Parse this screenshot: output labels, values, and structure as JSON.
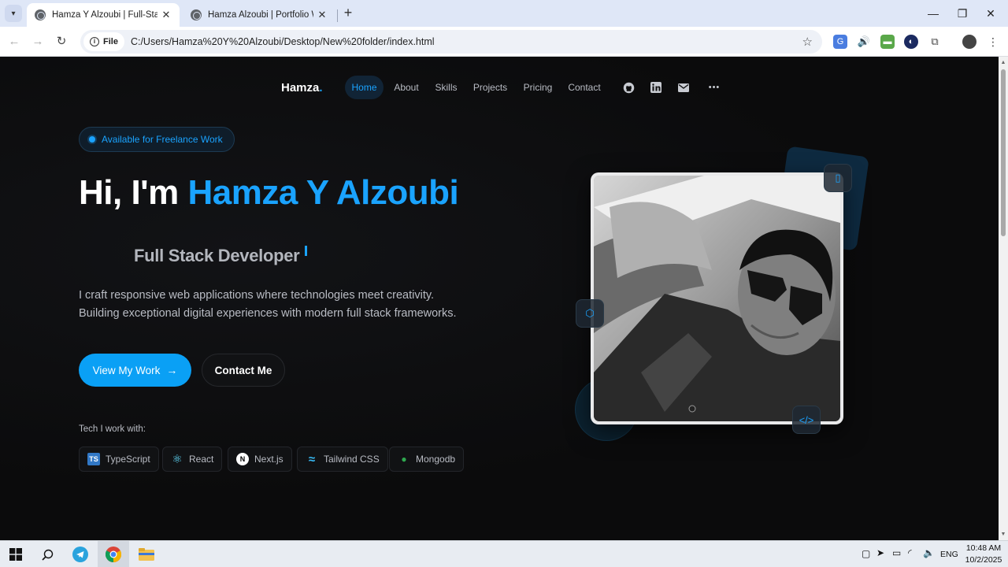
{
  "browser": {
    "tabs": [
      {
        "title": "Hamza Y Alzoubi | Full-Stack We",
        "active": true
      },
      {
        "title": "Hamza Alzoubi | Portfolio Webs",
        "active": false
      }
    ],
    "new_tab": "+",
    "window_controls": {
      "minimize": "—",
      "maximize": "❐",
      "close": "✕"
    },
    "site_chip": "File",
    "url": "C:/Users/Hamza%20Y%20Alzoubi/Desktop/New%20folder/index.html"
  },
  "nav": {
    "logo": "Hamza",
    "logo_dot": ".",
    "links": [
      "Home",
      "About",
      "Skills",
      "Projects",
      "Pricing",
      "Contact"
    ],
    "more": "•••"
  },
  "hero": {
    "badge": "Available for Freelance Work",
    "greeting": "Hi, I'm ",
    "name": "Hamza Y Alzoubi",
    "role": "Full Stack Developer",
    "description_line1": "I craft responsive web applications where technologies meet creativity.",
    "description_line2": "Building exceptional digital experiences with modern full stack frameworks.",
    "primary_button": "View My Work",
    "primary_arrow": "→",
    "secondary_button": "Contact Me",
    "tech_label": "Tech I work with:",
    "tech": [
      {
        "label": "TypeScript",
        "icon": "typescript-icon",
        "glyph": "TS"
      },
      {
        "label": "React",
        "icon": "react-icon",
        "glyph": "⚛"
      },
      {
        "label": "Next.js",
        "icon": "nextjs-icon",
        "glyph": "N"
      },
      {
        "label": "Tailwind CSS",
        "icon": "tailwind-icon",
        "glyph": "≈"
      },
      {
        "label": "Mongodb",
        "icon": "mongodb-icon",
        "glyph": "●"
      }
    ]
  },
  "colors": {
    "accent": "#1aa3ff",
    "background": "#0c0c0d",
    "text": "#b9bcc4"
  },
  "taskbar": {
    "time": "10:48 AM",
    "date": "10/2/2025",
    "lang": "ENG"
  }
}
